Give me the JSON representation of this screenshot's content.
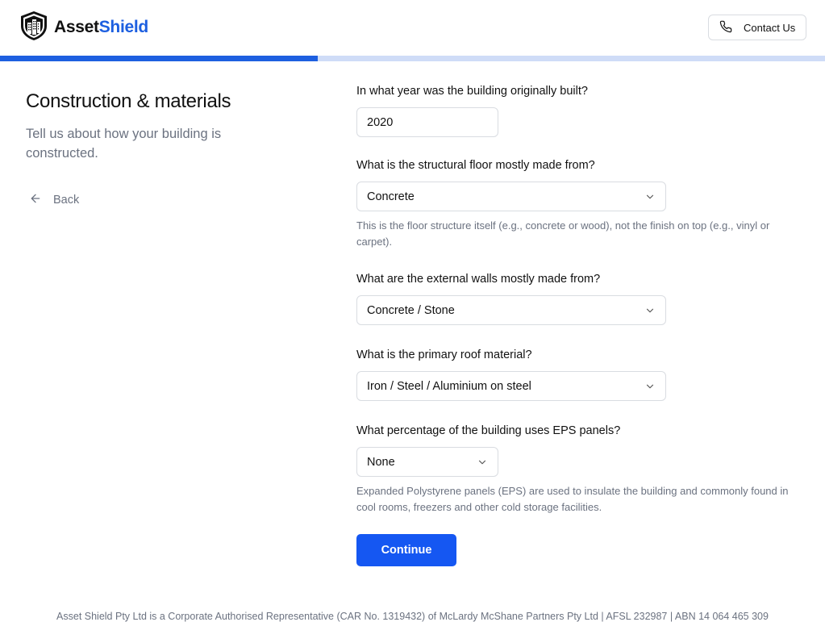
{
  "brand": {
    "name_part1": "Asset",
    "name_part2": "Shield",
    "accent_color": "#1d5fe0"
  },
  "header": {
    "contact_label": "Contact Us"
  },
  "progress": {
    "fraction": 0.385
  },
  "left": {
    "title": "Construction & materials",
    "subtitle": "Tell us about how your building is constructed.",
    "back_label": "Back"
  },
  "form": {
    "year": {
      "question": "In what year was the building originally built?",
      "value": "2020"
    },
    "floor": {
      "question": "What is the structural floor mostly made from?",
      "value": "Concrete",
      "helper": "This is the floor structure itself (e.g., concrete or wood), not the finish on top (e.g., vinyl or carpet)."
    },
    "walls": {
      "question": "What are the external walls mostly made from?",
      "value": "Concrete / Stone"
    },
    "roof": {
      "question": "What is the primary roof material?",
      "value": "Iron / Steel / Aluminium on steel"
    },
    "eps": {
      "question": "What percentage of the building uses EPS panels?",
      "value": "None",
      "helper": "Expanded Polystyrene panels (EPS) are used to insulate the building and commonly found in cool rooms, freezers and other cold storage facilities."
    },
    "continue_label": "Continue"
  },
  "footer": {
    "text": "Asset Shield Pty Ltd is a Corporate Authorised Representative (CAR No. 1319432) of McLardy McShane Partners Pty Ltd | AFSL 232987 | ABN 14 064 465 309"
  },
  "icons": {
    "logo": "shield-building-icon",
    "contact": "phone-icon",
    "back": "arrow-left-icon",
    "select": "chevron-down-icon"
  }
}
